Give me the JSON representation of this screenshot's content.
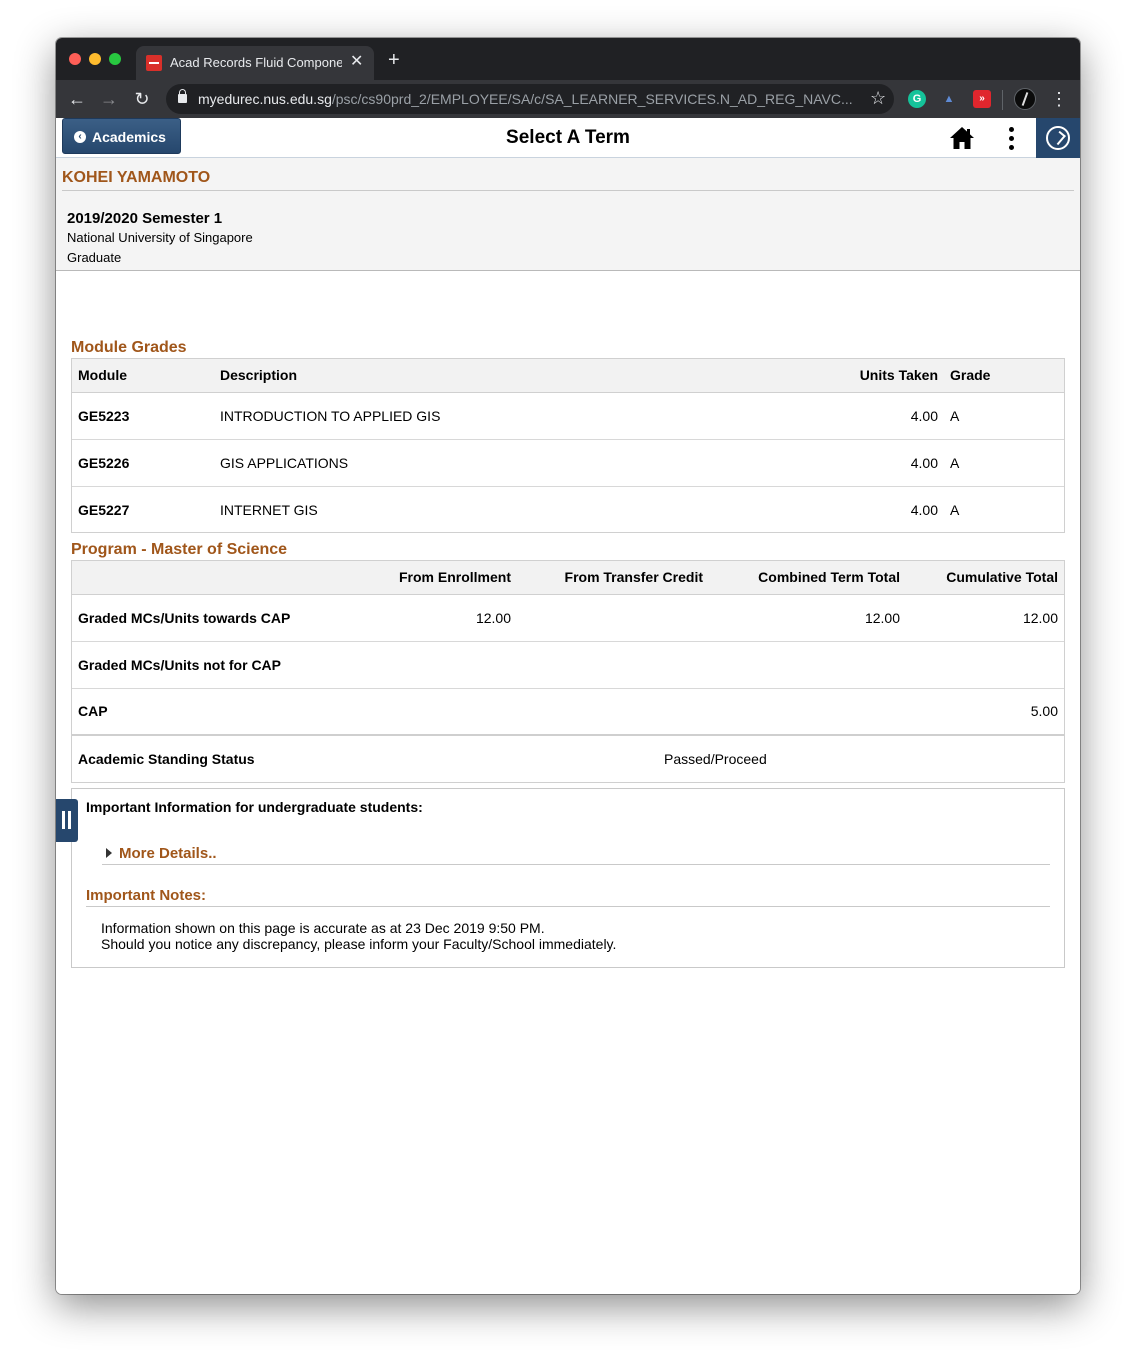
{
  "browser": {
    "tab_title": "Acad Records Fluid Component",
    "url_host": "myedurec.nus.edu.sg",
    "url_path": "/psc/cs90prd_2/EMPLOYEE/SA/c/SA_LEARNER_SERVICES.N_AD_REG_NAVC..."
  },
  "banner": {
    "back_label": "Academics",
    "title": "Select A Term"
  },
  "student": {
    "name": "KOHEI YAMAMOTO",
    "term": "2019/2020 Semester 1",
    "institution": "National University of Singapore",
    "career": "Graduate"
  },
  "module_grades": {
    "title": "Module Grades",
    "headers": {
      "module": "Module",
      "description": "Description",
      "units": "Units Taken",
      "grade": "Grade"
    },
    "rows": [
      {
        "module": "GE5223",
        "description": "INTRODUCTION TO APPLIED GIS",
        "units": "4.00",
        "grade": "A"
      },
      {
        "module": "GE5226",
        "description": "GIS APPLICATIONS",
        "units": "4.00",
        "grade": "A"
      },
      {
        "module": "GE5227",
        "description": "INTERNET GIS",
        "units": "4.00",
        "grade": "A"
      }
    ]
  },
  "program": {
    "title": "Program - Master of Science",
    "headers": {
      "enrollment": "From Enrollment",
      "transfer": "From Transfer Credit",
      "combined": "Combined Term Total",
      "cumulative": "Cumulative Total"
    },
    "rows": [
      {
        "label": "Graded MCs/Units towards CAP",
        "enrollment": "12.00",
        "transfer": "",
        "combined": "12.00",
        "cumulative": "12.00"
      },
      {
        "label": "Graded MCs/Units not for CAP",
        "enrollment": "",
        "transfer": "",
        "combined": "",
        "cumulative": ""
      },
      {
        "label": "CAP",
        "enrollment": "",
        "transfer": "",
        "combined": "",
        "cumulative": "5.00"
      }
    ],
    "standing_label": "Academic Standing Status",
    "standing_value": "Passed/Proceed"
  },
  "info": {
    "heading": "Important Information for undergraduate students:",
    "more_details": "More Details..",
    "notes_title": "Important Notes:",
    "notes_line1": "Information shown on this page is accurate as at 23 Dec 2019 9:50 PM.",
    "notes_line2": "Should you notice any discrepancy, please inform your Faculty/School immediately."
  },
  "colors": {
    "accent_brown": "#a0561a",
    "nav_blue": "#26476d"
  }
}
